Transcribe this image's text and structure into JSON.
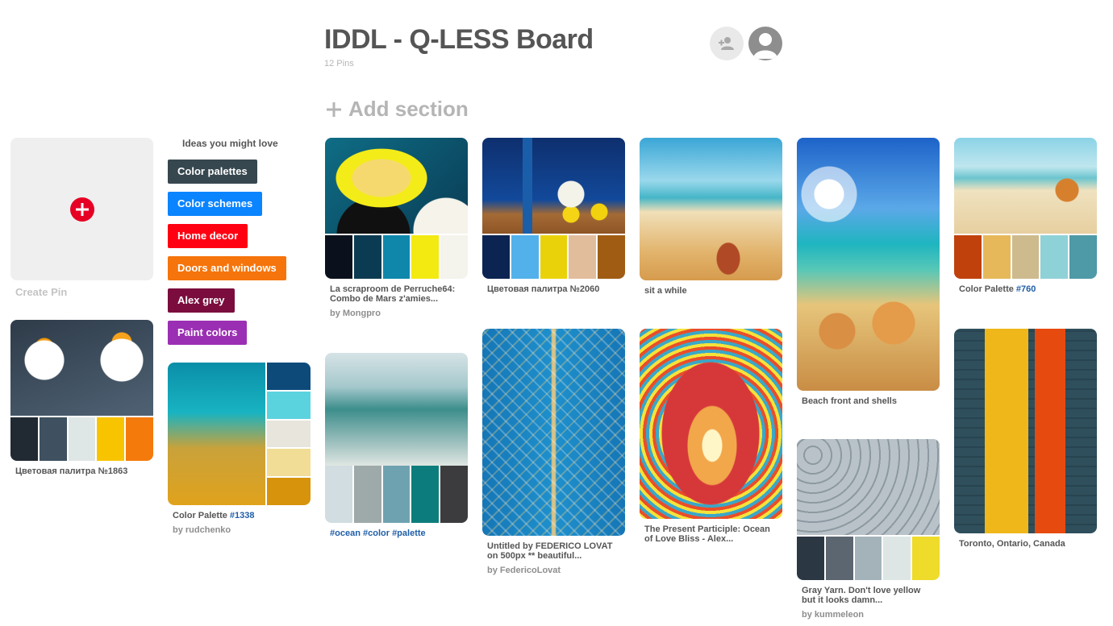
{
  "board": {
    "title": "IDDL - Q-LESS Board",
    "pin_count": "12 Pins",
    "add_section": "Add section"
  },
  "create_pin": {
    "label": "Create Pin"
  },
  "ideas": {
    "title": "Ideas you might love",
    "chips": [
      {
        "label": "Color palettes",
        "color": "#37474f"
      },
      {
        "label": "Color schemes",
        "color": "#0a84ff"
      },
      {
        "label": "Home decor",
        "color": "#ff0013"
      },
      {
        "label": "Doors and windows",
        "color": "#f5740b"
      },
      {
        "label": "Alex grey",
        "color": "#7a0d3d"
      },
      {
        "label": "Paint colors",
        "color": "#9b2fb3"
      }
    ]
  },
  "pins": {
    "eggs": {
      "title": "Цветовая палитра №1863",
      "palette": [
        "#212a33",
        "#3f5160",
        "#dfe6e6",
        "#f8c400",
        "#f47a0c"
      ]
    },
    "sea": {
      "title_prefix": "Color Palette ",
      "title_tag": "#1338",
      "author": "by rudchenko",
      "palette": [
        "#0d4a7a",
        "#5bd3df",
        "#e7e5dc",
        "#f1dd95",
        "#d7930b"
      ]
    },
    "yellow_cups": {
      "title": "La scraproom de Perruche64: Combo de Mars z'amies...",
      "author": "by Mongpro",
      "palette": [
        "#0b111c",
        "#0b3b52",
        "#0f87ab",
        "#f3ea11",
        "#f4f3ec"
      ]
    },
    "ocean": {
      "tags": [
        "#ocean",
        "#color",
        "#palette"
      ],
      "palette": [
        "#d1dde0",
        "#9ea9aa",
        "#6fa2b0",
        "#0c7d7c",
        "#3c3c3f"
      ]
    },
    "lemons": {
      "title": "Цветовая палитра №2060",
      "palette": [
        "#0b2452",
        "#52b1ea",
        "#ead20b",
        "#e2bd9c",
        "#a05c13"
      ]
    },
    "doors": {
      "title": "Untitled by FEDERICO LOVAT on 500px ** beautiful...",
      "author": "by FedericoLovat"
    },
    "beach_chair": {
      "title": "sit a while"
    },
    "alex": {
      "title": "The Present Participle: Ocean of Love Bliss - Alex..."
    },
    "starfish": {
      "title": "Beach front and shells"
    },
    "yarn": {
      "title": "Gray Yarn. Don't love yellow but it looks damn...",
      "author": "by kummeleon",
      "palette": [
        "#2c3744",
        "#5c6670",
        "#a3b3b9",
        "#dde6e5",
        "#eedb2a"
      ]
    },
    "palette760": {
      "title_prefix": "Color Palette ",
      "title_tag": "#760",
      "palette": [
        "#c0410b",
        "#e7b85a",
        "#cdbb8e",
        "#8ed1d6",
        "#4e9aa6"
      ]
    },
    "toronto": {
      "title": "Toronto, Ontario, Canada"
    }
  }
}
